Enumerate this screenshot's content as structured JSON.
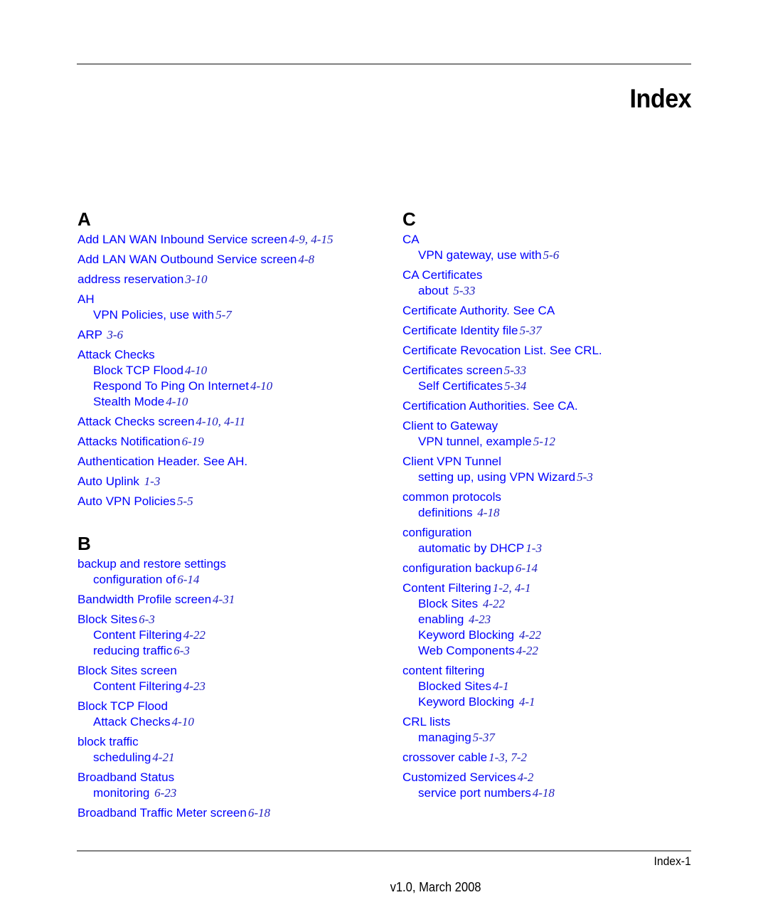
{
  "header": {
    "title": "Index"
  },
  "columns": [
    {
      "sections": [
        {
          "letter": "A",
          "entries": [
            {
              "lines": [
                {
                  "text": "Add LAN WAN Inbound Service screen",
                  "pages": "4-9, 4-15"
                }
              ]
            },
            {
              "lines": [
                {
                  "text": "Add LAN WAN Outbound Service screen",
                  "pages": "4-8"
                }
              ]
            },
            {
              "lines": [
                {
                  "text": "address reservation",
                  "pages": "3-10"
                }
              ]
            },
            {
              "lines": [
                {
                  "text": "AH",
                  "pages": ""
                },
                {
                  "text": "VPN Policies, use with",
                  "pages": "5-7",
                  "sub": true
                }
              ]
            },
            {
              "lines": [
                {
                  "text": "ARP ",
                  "pages": "3-6"
                }
              ]
            },
            {
              "lines": [
                {
                  "text": "Attack Checks",
                  "pages": ""
                },
                {
                  "text": "Block TCP Flood",
                  "pages": "4-10",
                  "sub": true
                },
                {
                  "text": "Respond To Ping On Internet",
                  "pages": "4-10",
                  "sub": true
                },
                {
                  "text": "Stealth Mode",
                  "pages": "4-10",
                  "sub": true
                }
              ]
            },
            {
              "lines": [
                {
                  "text": "Attack Checks screen",
                  "pages": "4-10, 4-11"
                }
              ]
            },
            {
              "lines": [
                {
                  "text": "Attacks Notification",
                  "pages": "6-19"
                }
              ]
            },
            {
              "lines": [
                {
                  "text": "Authentication Header. See AH.",
                  "pages": ""
                }
              ]
            },
            {
              "lines": [
                {
                  "text": "Auto Uplink ",
                  "pages": "1-3"
                }
              ]
            },
            {
              "lines": [
                {
                  "text": "Auto VPN Policies",
                  "pages": "5-5"
                }
              ]
            }
          ]
        },
        {
          "letter": "B",
          "entries": [
            {
              "lines": [
                {
                  "text": "backup and restore settings",
                  "pages": ""
                },
                {
                  "text": "configuration of",
                  "pages": "6-14",
                  "sub": true
                }
              ]
            },
            {
              "lines": [
                {
                  "text": "Bandwidth Profile screen",
                  "pages": "4-31"
                }
              ]
            },
            {
              "lines": [
                {
                  "text": "Block Sites",
                  "pages": "6-3"
                },
                {
                  "text": "Content Filtering",
                  "pages": "4-22",
                  "sub": true
                },
                {
                  "text": "reducing traffic",
                  "pages": "6-3",
                  "sub": true
                }
              ]
            },
            {
              "lines": [
                {
                  "text": "Block Sites screen",
                  "pages": ""
                },
                {
                  "text": "Content Filtering",
                  "pages": "4-23",
                  "sub": true
                }
              ]
            },
            {
              "lines": [
                {
                  "text": "Block TCP Flood",
                  "pages": ""
                },
                {
                  "text": "Attack Checks",
                  "pages": "4-10",
                  "sub": true
                }
              ]
            },
            {
              "lines": [
                {
                  "text": "block traffic",
                  "pages": ""
                },
                {
                  "text": "scheduling",
                  "pages": "4-21",
                  "sub": true
                }
              ]
            },
            {
              "lines": [
                {
                  "text": "Broadband Status",
                  "pages": ""
                },
                {
                  "text": "monitoring ",
                  "pages": "6-23",
                  "sub": true
                }
              ]
            },
            {
              "lines": [
                {
                  "text": "Broadband Traffic Meter screen",
                  "pages": "6-18"
                }
              ]
            }
          ]
        }
      ]
    },
    {
      "sections": [
        {
          "letter": "C",
          "entries": [
            {
              "lines": [
                {
                  "text": "CA",
                  "pages": ""
                },
                {
                  "text": "VPN gateway, use with",
                  "pages": "5-6",
                  "sub": true
                }
              ]
            },
            {
              "lines": [
                {
                  "text": "CA Certificates",
                  "pages": ""
                },
                {
                  "text": "about ",
                  "pages": "5-33",
                  "sub": true
                }
              ]
            },
            {
              "lines": [
                {
                  "text": "Certificate Authority. See CA",
                  "pages": ""
                }
              ]
            },
            {
              "lines": [
                {
                  "text": "Certificate Identity file",
                  "pages": "5-37"
                }
              ]
            },
            {
              "lines": [
                {
                  "text": "Certificate Revocation List. See CRL.",
                  "pages": ""
                }
              ]
            },
            {
              "lines": [
                {
                  "text": "Certificates screen",
                  "pages": "5-33"
                },
                {
                  "text": "Self Certificates",
                  "pages": "5-34",
                  "sub": true
                }
              ]
            },
            {
              "lines": [
                {
                  "text": "Certification Authorities. See CA.",
                  "pages": ""
                }
              ]
            },
            {
              "lines": [
                {
                  "text": "Client to Gateway",
                  "pages": ""
                },
                {
                  "text": "VPN tunnel, example",
                  "pages": "5-12",
                  "sub": true
                }
              ]
            },
            {
              "lines": [
                {
                  "text": "Client VPN Tunnel",
                  "pages": ""
                },
                {
                  "text": "setting up, using VPN Wizard",
                  "pages": "5-3",
                  "sub": true
                }
              ]
            },
            {
              "lines": [
                {
                  "text": "common protocols",
                  "pages": ""
                },
                {
                  "text": "definitions ",
                  "pages": "4-18",
                  "sub": true
                }
              ]
            },
            {
              "lines": [
                {
                  "text": "configuration",
                  "pages": ""
                },
                {
                  "text": "automatic by DHCP",
                  "pages": "1-3",
                  "sub": true
                }
              ]
            },
            {
              "lines": [
                {
                  "text": "configuration backup",
                  "pages": "6-14"
                }
              ]
            },
            {
              "lines": [
                {
                  "text": "Content Filtering",
                  "pages": "1-2, 4-1"
                },
                {
                  "text": "Block Sites ",
                  "pages": "4-22",
                  "sub": true
                },
                {
                  "text": "enabling ",
                  "pages": "4-23",
                  "sub": true
                },
                {
                  "text": "Keyword Blocking ",
                  "pages": "4-22",
                  "sub": true
                },
                {
                  "text": "Web Components",
                  "pages": "4-22",
                  "sub": true
                }
              ]
            },
            {
              "lines": [
                {
                  "text": "content filtering",
                  "pages": ""
                },
                {
                  "text": "Blocked Sites",
                  "pages": "4-1",
                  "sub": true
                },
                {
                  "text": "Keyword Blocking ",
                  "pages": "4-1",
                  "sub": true
                }
              ]
            },
            {
              "lines": [
                {
                  "text": "CRL lists",
                  "pages": ""
                },
                {
                  "text": "managing",
                  "pages": "5-37",
                  "sub": true
                }
              ]
            },
            {
              "lines": [
                {
                  "text": "crossover cable",
                  "pages": "1-3, 7-2"
                }
              ]
            },
            {
              "lines": [
                {
                  "text": "Customized Services",
                  "pages": "4-2"
                },
                {
                  "text": "service port numbers",
                  "pages": "4-18",
                  "sub": true
                }
              ]
            }
          ]
        }
      ]
    }
  ],
  "footer": {
    "page_label": "Index-1",
    "version": "v1.0, March 2008"
  },
  "colors": {
    "link": "#0000ff",
    "page_ref": "#2020c0",
    "rule": "#808080"
  }
}
